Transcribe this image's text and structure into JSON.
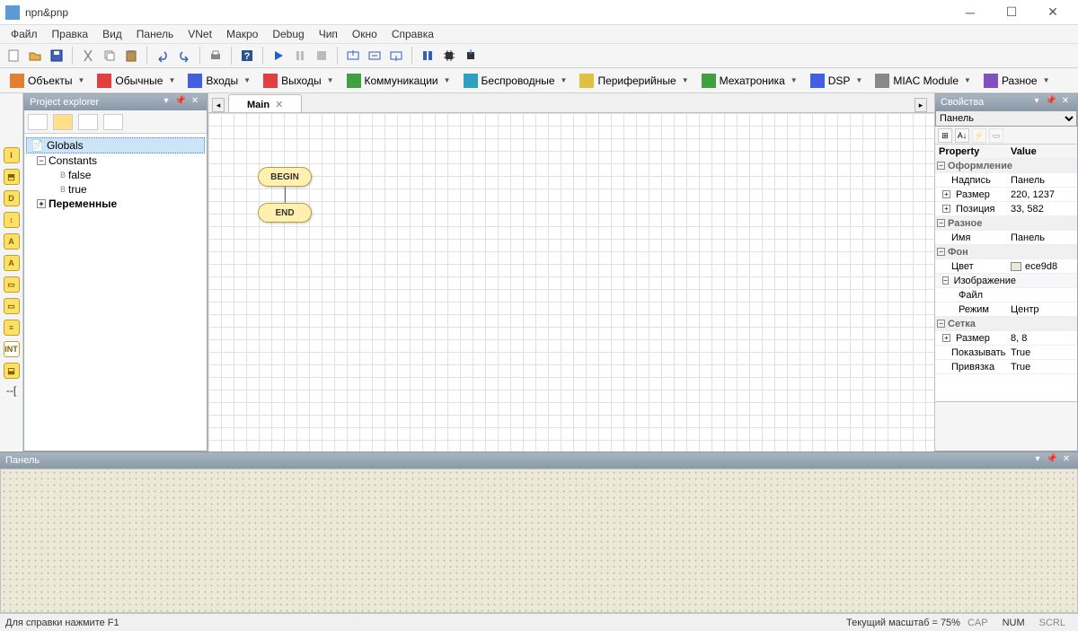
{
  "window": {
    "title": "npn&pnp"
  },
  "menu": [
    "Файл",
    "Правка",
    "Вид",
    "Панель",
    "VNet",
    "Макро",
    "Debug",
    "Чип",
    "Окно",
    "Справка"
  ],
  "compbar": [
    {
      "label": "Объекты",
      "color": "ic-orange"
    },
    {
      "label": "Обычные",
      "color": "ic-red"
    },
    {
      "label": "Входы",
      "color": "ic-blue"
    },
    {
      "label": "Выходы",
      "color": "ic-red"
    },
    {
      "label": "Коммуникации",
      "color": "ic-green"
    },
    {
      "label": "Беспроводные",
      "color": "ic-cyan"
    },
    {
      "label": "Периферийные",
      "color": "ic-yellow"
    },
    {
      "label": "Мехатроника",
      "color": "ic-green"
    },
    {
      "label": "DSP",
      "color": "ic-blue"
    },
    {
      "label": "MIAC Module",
      "color": "ic-gray"
    },
    {
      "label": "Разное",
      "color": "ic-purple"
    }
  ],
  "explorer": {
    "title": "Project explorer",
    "root": "Globals",
    "nodes": {
      "constants": "Constants",
      "false": "false",
      "true": "true",
      "vars": "Переменные"
    }
  },
  "tabs": {
    "main": "Main"
  },
  "flow": {
    "begin": "BEGIN",
    "end": "END"
  },
  "props": {
    "title": "Свойства",
    "selector": "Панель",
    "groups": {
      "g1": "Оформление",
      "g2": "Разное",
      "g3": "Фон",
      "g3b": "Изображение",
      "g4": "Сетка"
    },
    "rows": {
      "caption_k": "Надпись",
      "caption_v": "Панель",
      "size_k": "Размер",
      "size_v": "220, 1237",
      "pos_k": "Позиция",
      "pos_v": "33, 582",
      "name_k": "Имя",
      "name_v": "Панель",
      "color_k": "Цвет",
      "color_v": "ece9d8",
      "file_k": "Файл",
      "file_v": "",
      "mode_k": "Режим",
      "mode_v": "Центр",
      "gsize_k": "Размер",
      "gsize_v": "8, 8",
      "show_k": "Показывать",
      "show_v": "True",
      "snap_k": "Привязка",
      "snap_v": "True"
    },
    "header_prop": "Property",
    "header_val": "Value"
  },
  "bottompanel": {
    "title": "Панель"
  },
  "status": {
    "help": "Для справки нажмите F1",
    "zoom": "Текущий масштаб = 75%",
    "cap": "CAP",
    "num": "NUM",
    "scrl": "SCRL"
  }
}
